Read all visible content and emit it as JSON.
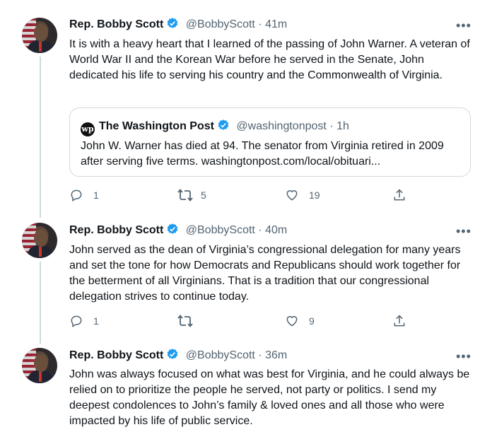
{
  "tweets": [
    {
      "name": "Rep. Bobby Scott",
      "handle": "@BobbyScott",
      "sep": " · ",
      "time": "41m",
      "text": "It is with a heavy heart that I learned of the passing of John Warner. A veteran of World War II and the Korean War before he served in the Senate, John dedicated his life to serving his country and the Commonwealth of Virginia.",
      "quote": {
        "name": "The Washington Post",
        "handle": "@washingtonpost",
        "sep": " · ",
        "time": "1h",
        "text": "John W. Warner has died at 94. The senator from Virginia retired in 2009 after serving five terms. washingtonpost.com/local/obituari..."
      },
      "replies": "1",
      "retweets": "5",
      "likes": "19"
    },
    {
      "name": "Rep. Bobby Scott",
      "handle": "@BobbyScott",
      "sep": " · ",
      "time": "40m",
      "text": "John served as the dean of Virginia’s congressional delegation for many years and set the tone for how Democrats and Republicans should work together for the betterment of all Virginians. That is a tradition that our congressional delegation strives to continue today.",
      "replies": "1",
      "retweets": "",
      "likes": "9"
    },
    {
      "name": "Rep. Bobby Scott",
      "handle": "@BobbyScott",
      "sep": " · ",
      "time": "36m",
      "text": "John was always focused on what was best for Virginia, and he could always be relied on to prioritize the people he served, not party or politics. I send my deepest condolences to John’s family & loved ones and all those who were impacted by his life of public service."
    }
  ],
  "more_label": "•••",
  "quote_logo": "wp",
  "colors": {
    "verified": "#1d9bf0",
    "muted": "#536471"
  }
}
